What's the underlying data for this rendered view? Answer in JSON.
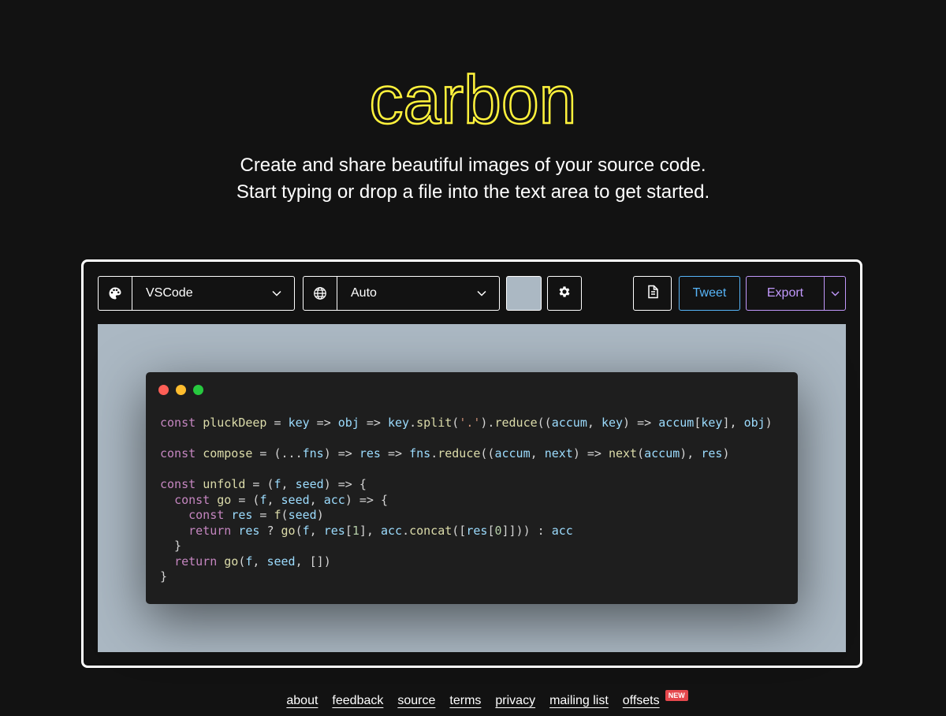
{
  "brand": {
    "logo_text": "carbon",
    "logo_color": "#fff23c"
  },
  "tagline": {
    "line1": "Create and share beautiful images of your source code.",
    "line2": "Start typing or drop a file into the text area to get started."
  },
  "toolbar": {
    "theme": {
      "icon": "palette-icon",
      "value": "VSCode"
    },
    "language": {
      "icon": "globe-icon",
      "value": "Auto"
    },
    "background_color": "#abb8c3",
    "settings_icon": "gear-icon",
    "copy_icon": "copy-icon",
    "tweet_label": "Tweet",
    "export_label": "Export"
  },
  "code_lines": [
    [
      [
        "k",
        "const "
      ],
      [
        "f",
        "pluckDeep"
      ],
      [
        "o",
        " = "
      ],
      [
        "v",
        "key"
      ],
      [
        "o",
        " => "
      ],
      [
        "v",
        "obj"
      ],
      [
        "o",
        " => "
      ],
      [
        "v",
        "key"
      ],
      [
        "o",
        "."
      ],
      [
        "f",
        "split"
      ],
      [
        "o",
        "("
      ],
      [
        "s",
        "'.'"
      ],
      [
        "o",
        ")."
      ],
      [
        "f",
        "reduce"
      ],
      [
        "o",
        "(("
      ],
      [
        "v",
        "accum"
      ],
      [
        "o",
        ", "
      ],
      [
        "v",
        "key"
      ],
      [
        "o",
        ") => "
      ],
      [
        "v",
        "accum"
      ],
      [
        "o",
        "["
      ],
      [
        "v",
        "key"
      ],
      [
        "o",
        "], "
      ],
      [
        "v",
        "obj"
      ],
      [
        "o",
        ")"
      ]
    ],
    [],
    [
      [
        "k",
        "const "
      ],
      [
        "f",
        "compose"
      ],
      [
        "o",
        " = (..."
      ],
      [
        "v",
        "fns"
      ],
      [
        "o",
        ") => "
      ],
      [
        "v",
        "res"
      ],
      [
        "o",
        " => "
      ],
      [
        "v",
        "fns"
      ],
      [
        "o",
        "."
      ],
      [
        "f",
        "reduce"
      ],
      [
        "o",
        "(("
      ],
      [
        "v",
        "accum"
      ],
      [
        "o",
        ", "
      ],
      [
        "v",
        "next"
      ],
      [
        "o",
        ") => "
      ],
      [
        "f",
        "next"
      ],
      [
        "o",
        "("
      ],
      [
        "v",
        "accum"
      ],
      [
        "o",
        "), "
      ],
      [
        "v",
        "res"
      ],
      [
        "o",
        ")"
      ]
    ],
    [],
    [
      [
        "k",
        "const "
      ],
      [
        "f",
        "unfold"
      ],
      [
        "o",
        " = ("
      ],
      [
        "v",
        "f"
      ],
      [
        "o",
        ", "
      ],
      [
        "v",
        "seed"
      ],
      [
        "o",
        ") => {"
      ]
    ],
    [
      [
        "o",
        "  "
      ],
      [
        "k",
        "const "
      ],
      [
        "f",
        "go"
      ],
      [
        "o",
        " = ("
      ],
      [
        "v",
        "f"
      ],
      [
        "o",
        ", "
      ],
      [
        "v",
        "seed"
      ],
      [
        "o",
        ", "
      ],
      [
        "v",
        "acc"
      ],
      [
        "o",
        ") => {"
      ]
    ],
    [
      [
        "o",
        "    "
      ],
      [
        "k",
        "const "
      ],
      [
        "v",
        "res"
      ],
      [
        "o",
        " = "
      ],
      [
        "f",
        "f"
      ],
      [
        "o",
        "("
      ],
      [
        "v",
        "seed"
      ],
      [
        "o",
        ")"
      ]
    ],
    [
      [
        "o",
        "    "
      ],
      [
        "k",
        "return "
      ],
      [
        "v",
        "res"
      ],
      [
        "o",
        " ? "
      ],
      [
        "f",
        "go"
      ],
      [
        "o",
        "("
      ],
      [
        "v",
        "f"
      ],
      [
        "o",
        ", "
      ],
      [
        "v",
        "res"
      ],
      [
        "o",
        "["
      ],
      [
        "n",
        "1"
      ],
      [
        "o",
        "], "
      ],
      [
        "v",
        "acc"
      ],
      [
        "o",
        "."
      ],
      [
        "f",
        "concat"
      ],
      [
        "o",
        "(["
      ],
      [
        "v",
        "res"
      ],
      [
        "o",
        "["
      ],
      [
        "n",
        "0"
      ],
      [
        "o",
        "]])) : "
      ],
      [
        "v",
        "acc"
      ]
    ],
    [
      [
        "o",
        "  }"
      ]
    ],
    [
      [
        "o",
        "  "
      ],
      [
        "k",
        "return "
      ],
      [
        "f",
        "go"
      ],
      [
        "o",
        "("
      ],
      [
        "v",
        "f"
      ],
      [
        "o",
        ", "
      ],
      [
        "v",
        "seed"
      ],
      [
        "o",
        ", [])"
      ]
    ],
    [
      [
        "o",
        "}"
      ]
    ]
  ],
  "footer": {
    "links": [
      "about",
      "feedback",
      "source",
      "terms",
      "privacy",
      "mailing list",
      "offsets"
    ],
    "badge": "NEW"
  }
}
